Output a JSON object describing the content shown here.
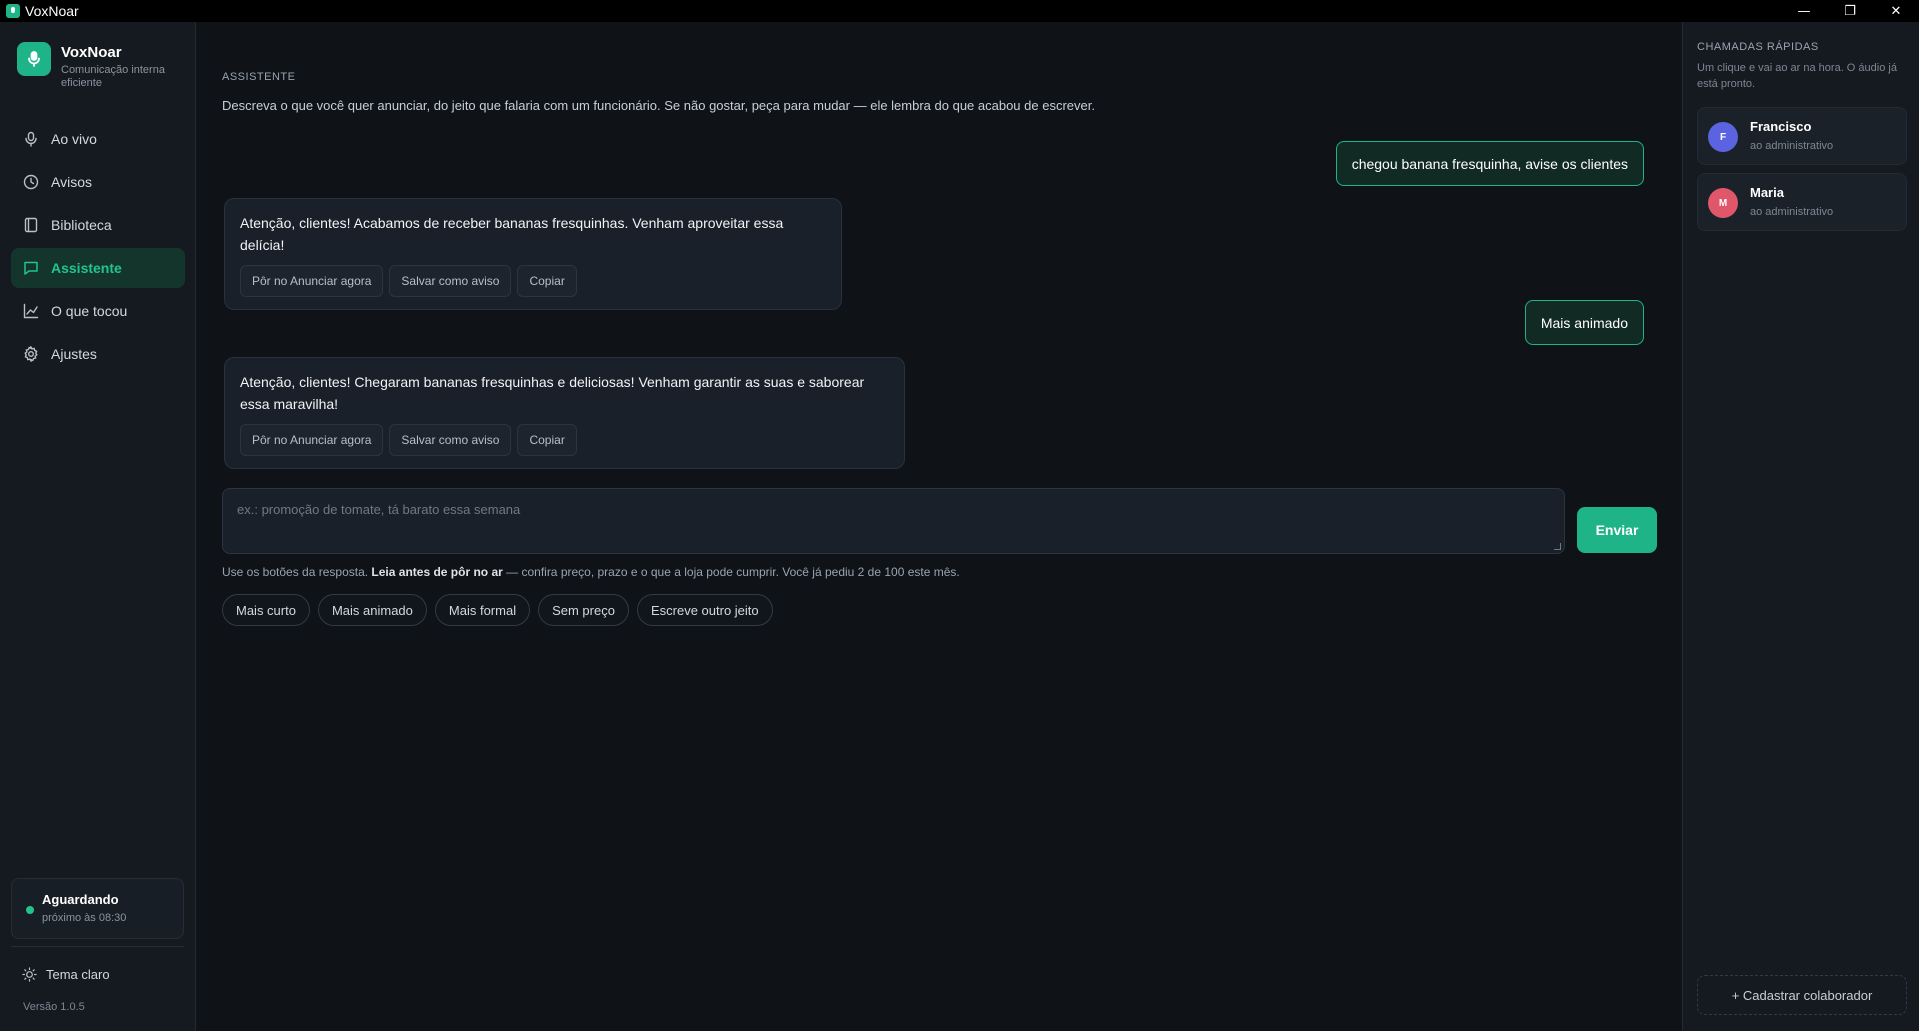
{
  "window": {
    "title": "VoxNoar",
    "controls": [
      "—",
      "❐",
      "✕"
    ]
  },
  "brand": {
    "name": "VoxNoar",
    "subtitle": "Comunicação interna eficiente",
    "icon": "microphone-icon"
  },
  "nav": {
    "items": [
      {
        "label": "Ao vivo",
        "icon": "microphone-icon"
      },
      {
        "label": "Avisos",
        "icon": "clock-icon"
      },
      {
        "label": "Biblioteca",
        "icon": "book-icon"
      },
      {
        "label": "Assistente",
        "icon": "chat-icon",
        "active": true
      },
      {
        "label": "O que tocou",
        "icon": "line-chart-icon"
      },
      {
        "label": "Ajustes",
        "icon": "gear-icon"
      }
    ]
  },
  "status": {
    "title": "Aguardando",
    "subtitle": "próximo às 08:30",
    "color": "#22c38f"
  },
  "theme_toggle": {
    "label": "Tema claro",
    "icon": "sun-icon"
  },
  "version": "Versão 1.0.5",
  "assistant": {
    "section_label": "ASSISTENTE",
    "description": "Descreva o que você quer anunciar, do jeito que falaria com um funcionário. Se não gostar, peça para mudar — ele lembra do que acabou de escrever.",
    "messages": [
      {
        "role": "user",
        "text": "chegou banana fresquinha, avise os clientes"
      },
      {
        "role": "assistant",
        "text": "Atenção, clientes! Acabamos de receber bananas fresquinhas. Venham aproveitar essa delícia!"
      },
      {
        "role": "user",
        "text": "Mais animado"
      },
      {
        "role": "assistant",
        "text": "Atenção, clientes! Chegaram bananas fresquinhas e deliciosas! Venham garantir as suas e saborear essa maravilha!"
      }
    ],
    "actions": {
      "announce": "Pôr no Anunciar agora",
      "save": "Salvar como aviso",
      "copy": "Copiar"
    },
    "input_placeholder": "ex.: promoção de tomate, tá barato essa semana",
    "send_label": "Enviar",
    "hint_prefix": "Use os botões da resposta. ",
    "hint_bold": "Leia antes de pôr no ar",
    "hint_suffix": " — confira preço, prazo e o que a loja pode cumprir. Você já pediu 2 de 100 este mês.",
    "chips": [
      "Mais curto",
      "Mais animado",
      "Mais formal",
      "Sem preço",
      "Escreve outro jeito"
    ]
  },
  "quick_calls": {
    "title": "CHAMADAS RÁPIDAS",
    "description": "Um clique e vai ao ar na hora. O áudio já está pronto.",
    "contacts": [
      {
        "initial": "F",
        "name": "Francisco",
        "role": "ao administrativo",
        "color": "#5b63e0"
      },
      {
        "initial": "M",
        "name": "Maria",
        "role": "ao administrativo",
        "color": "#e0566a"
      }
    ],
    "add_label": "+ Cadastrar colaborador"
  },
  "colors": {
    "accent": "#1fb487",
    "background": "#0f1318",
    "panel": "#151a21"
  }
}
